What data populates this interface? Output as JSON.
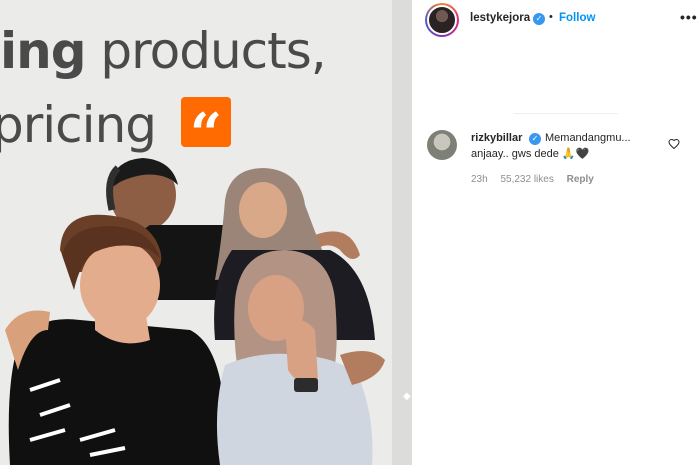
{
  "photo": {
    "sign_line1_bold": "ing",
    "sign_line1_rest": " products,",
    "sign_line2": "pricing",
    "quote_badge": "“"
  },
  "post": {
    "owner_username": "lestykejora",
    "separator": "•",
    "follow_label": "Follow",
    "more_icon": "•••"
  },
  "comment": {
    "username": "rizkybillar",
    "text_line1": "Memandangmu...",
    "text_line2": "anjaay.. gws dede 🙏🖤",
    "age": "23h",
    "likes": "55,232 likes",
    "reply_label": "Reply"
  },
  "colors": {
    "follow_blue": "#0095f6",
    "verified_blue": "#3897f0",
    "muted_gray": "#8e8e8e",
    "badge_orange": "#ff6b00"
  },
  "icons": [
    "verified-badge-icon",
    "more-options-icon",
    "heart-icon"
  ]
}
